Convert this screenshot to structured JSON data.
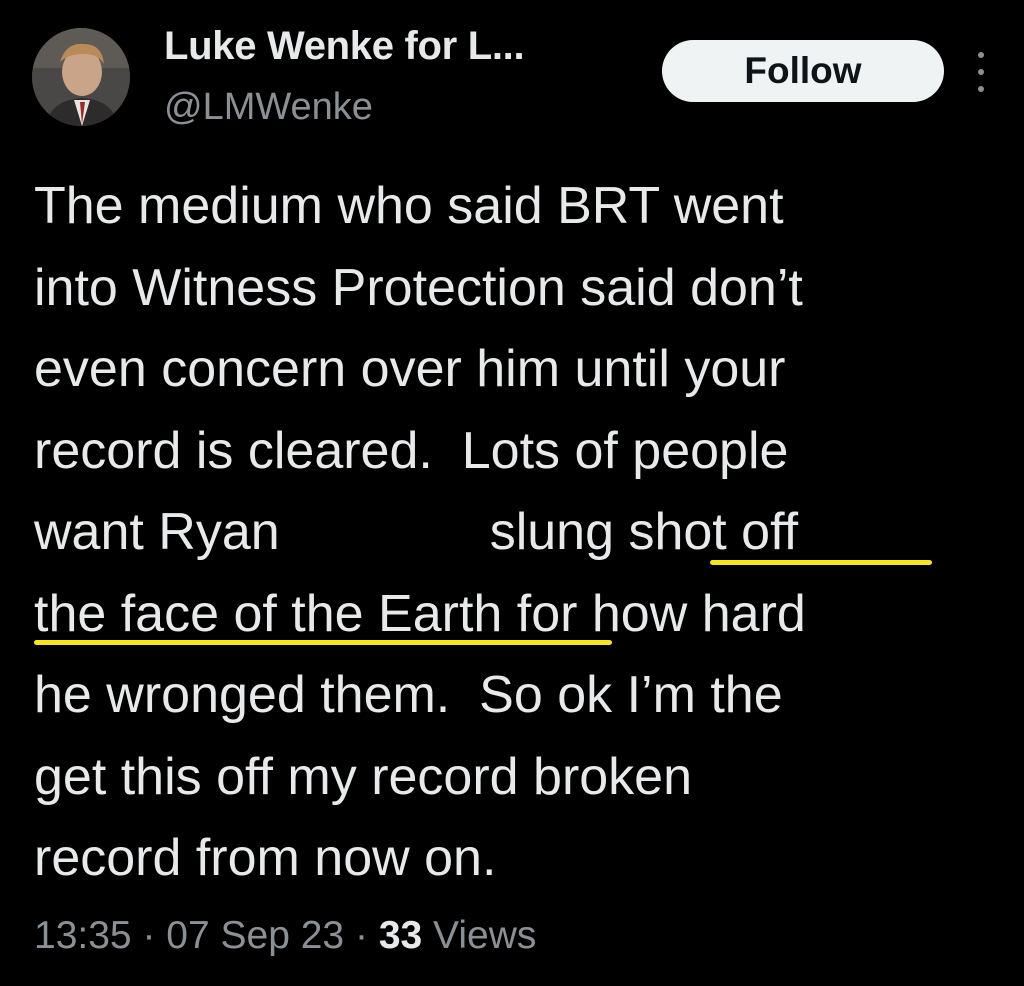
{
  "author": {
    "display_name": "Luke Wenke for L...",
    "handle": "@LMWenke",
    "avatar_icon": "profile-photo"
  },
  "actions": {
    "follow_label": "Follow",
    "more_icon": "more-vertical-icon"
  },
  "tweet": {
    "lines": [
      "The medium who said BRT went",
      "into Witness Protection said don’t",
      "even concern over him until your",
      "record is cleared.  Lots of people"
    ],
    "line5_before_gap": "want Ryan",
    "line5_after_gap": "slung shot off",
    "line6": "the face of the Earth for how hard",
    "lines_end": [
      "he wronged them.  So ok I’m the",
      "get this off my record broken",
      "record from now on."
    ],
    "highlighted_phrase": "shot off the face of the Earth",
    "highlight_color": "#f7e51e"
  },
  "meta": {
    "time": "13:35",
    "separator": "·",
    "date": "07 Sep 23",
    "views_count": "33",
    "views_label": "Views"
  },
  "colors": {
    "background": "#000000",
    "primary_text": "#e7e9ea",
    "secondary_text": "#8b9095",
    "follow_bg": "#eff3f4"
  }
}
